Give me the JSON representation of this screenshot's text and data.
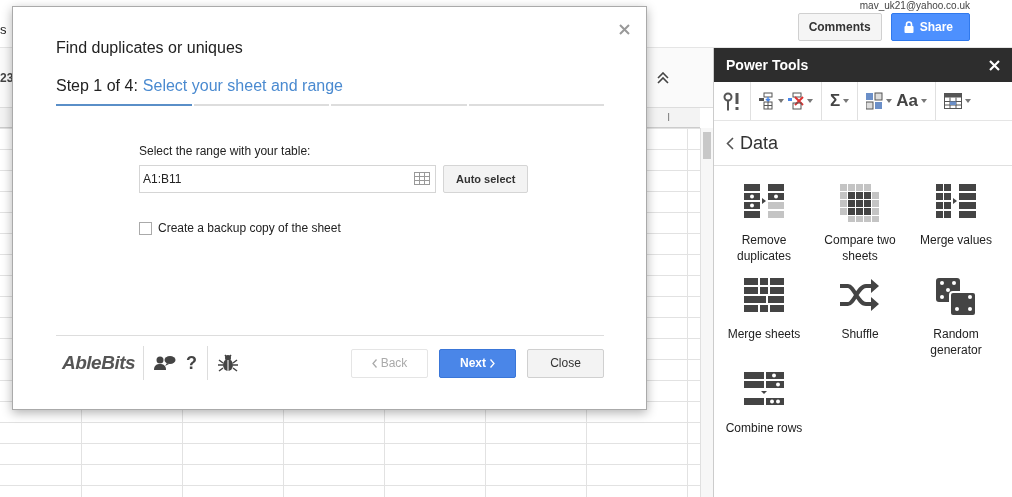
{
  "account": {
    "email": "mav_uk21@yahoo.co.uk"
  },
  "header_buttons": [
    {
      "label": "Comments",
      "kind": "plain"
    },
    {
      "label": "Share",
      "kind": "primary"
    }
  ],
  "sheet": {
    "menu_fragment": "s",
    "toolbar_fragment": "23",
    "column_label": "I"
  },
  "dialog": {
    "title": "Find duplicates or uniques",
    "step_prefix": "Step 1 of 4:",
    "step_name": "Select your sheet and range",
    "steps": [
      {
        "selected": true
      },
      {
        "selected": false
      },
      {
        "selected": false
      },
      {
        "selected": false
      }
    ],
    "range_label": "Select the range with your table:",
    "range_value": "A1:B11",
    "auto_select": "Auto select",
    "backup": {
      "label": "Create a backup copy of the sheet",
      "checked": false
    },
    "brand": "AbleBits",
    "help": "?",
    "buttons": [
      {
        "label": "Back",
        "kind": "back",
        "disabled": true
      },
      {
        "label": "Next",
        "kind": "next",
        "disabled": false
      },
      {
        "label": "Close",
        "kind": "close",
        "disabled": false
      }
    ]
  },
  "panel": {
    "title": "Power Tools",
    "section": "Data",
    "toolbar_groups": [
      [
        {
          "kind": "icon",
          "dropdown": false
        }
      ],
      [
        {
          "kind": "icon",
          "dropdown": true
        },
        {
          "kind": "icon",
          "dropdown": true
        }
      ],
      [
        {
          "kind": "text",
          "text": "Σ",
          "dropdown": true
        }
      ],
      [
        {
          "kind": "icon",
          "dropdown": true
        },
        {
          "kind": "text",
          "text": "Aa",
          "dropdown": true
        }
      ],
      [
        {
          "kind": "icon",
          "dropdown": true
        }
      ]
    ],
    "tools": [
      "Remove duplicates",
      "Compare two sheets",
      "Merge values",
      "Merge sheets",
      "Shuffle",
      "Random generator",
      "Combine rows"
    ]
  }
}
